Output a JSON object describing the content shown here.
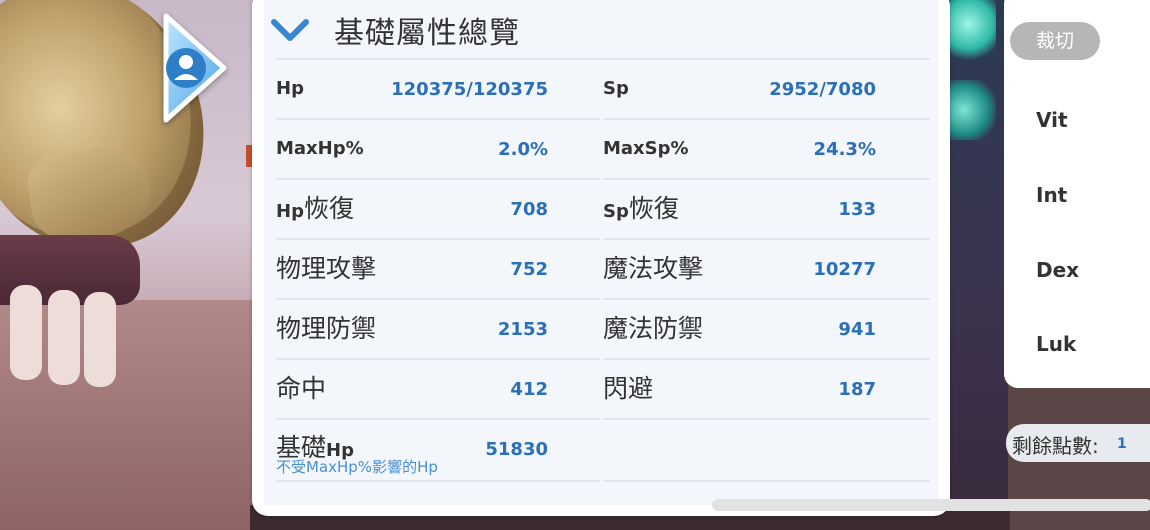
{
  "panel": {
    "title": "基礎屬性總覽",
    "collapse_icon": "chevron-down-icon"
  },
  "stats": [
    {
      "left": {
        "label": "Hp",
        "value": "120375/120375",
        "small": true
      },
      "right": {
        "label": "Sp",
        "value": "2952/7080",
        "small": true
      }
    },
    {
      "left": {
        "label": "MaxHp%",
        "value": "2.0%",
        "small": true
      },
      "right": {
        "label": "MaxSp%",
        "value": "24.3%",
        "small": true
      }
    },
    {
      "left": {
        "label_prefix": "Hp",
        "label_suffix": "恢復",
        "value": "708"
      },
      "right": {
        "label_prefix": "Sp",
        "label_suffix": "恢復",
        "value": "133"
      }
    },
    {
      "left": {
        "label": "物理攻擊",
        "value": "752"
      },
      "right": {
        "label": "魔法攻擊",
        "value": "10277"
      }
    },
    {
      "left": {
        "label": "物理防禦",
        "value": "2153"
      },
      "right": {
        "label": "魔法防禦",
        "value": "941"
      }
    },
    {
      "left": {
        "label": "命中",
        "value": "412"
      },
      "right": {
        "label": "閃避",
        "value": "187"
      }
    }
  ],
  "base_hp": {
    "label_prefix": "基礎",
    "label_suffix": "Hp",
    "sublabel": "不受MaxHp%影響的Hp",
    "value": "51830"
  },
  "side": {
    "stats": [
      "Vit",
      "Int",
      "Dex",
      "Luk"
    ],
    "remaining_label": "剩餘點數:",
    "remaining_value": "1",
    "crop_button": "裁切"
  },
  "colors": {
    "value_blue": "#2a6fb8",
    "sublabel_blue": "#4a8fd4",
    "chevron_blue": "#3a86d0"
  }
}
